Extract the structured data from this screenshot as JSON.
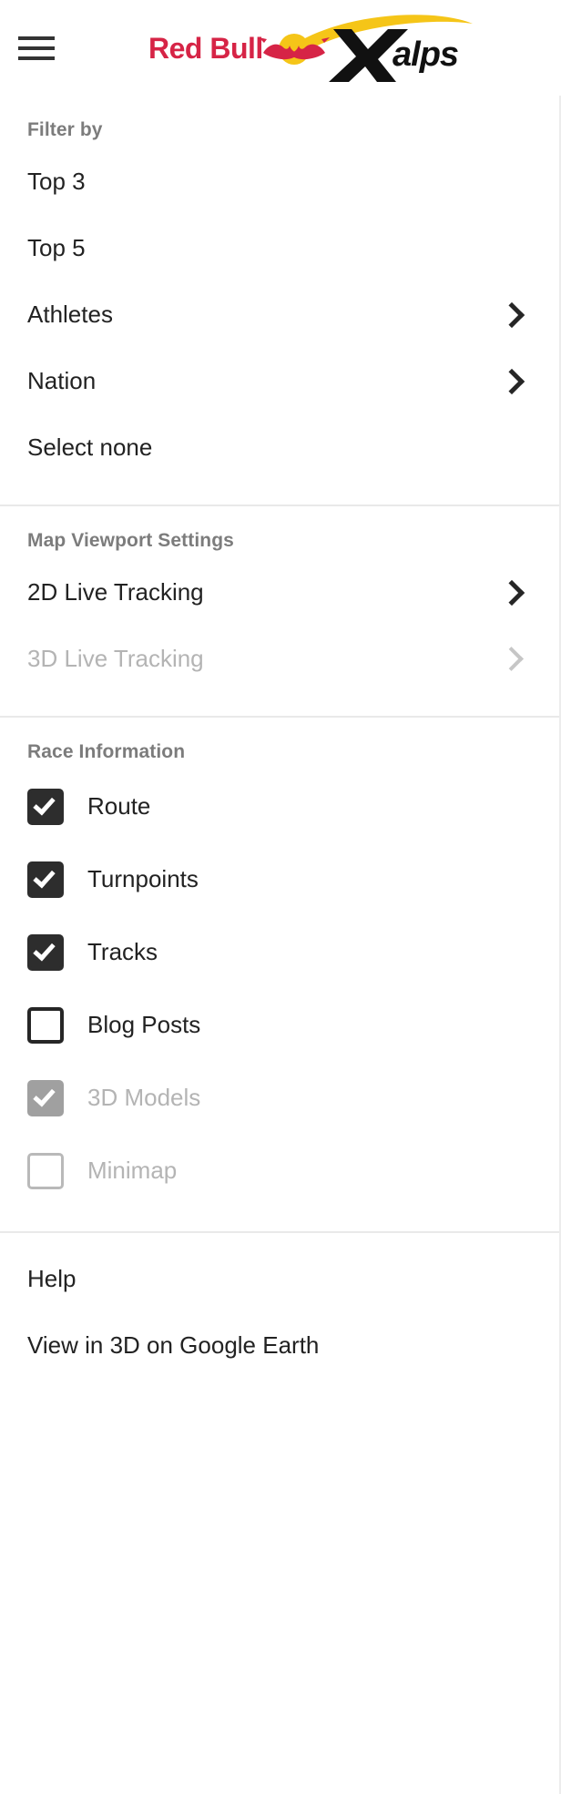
{
  "header": {
    "menu_icon": "hamburger-menu-icon",
    "logo_text_red": "Red Bull",
    "logo_text_black": "X-alps",
    "logo_alt": "Red Bull X-Alps"
  },
  "colors": {
    "redbull_red": "#D62446",
    "redbull_yellow": "#F5C518",
    "text_primary": "#222222",
    "text_muted": "#7C7C7C",
    "text_disabled": "#B4B4B4",
    "checkbox_checked": "#2D2D2D",
    "checkbox_disabled": "#A0A0A0",
    "divider": "#E9E9E9"
  },
  "sections": {
    "filter": {
      "title": "Filter by",
      "items": [
        {
          "label": "Top 3",
          "chevron": false,
          "disabled": false
        },
        {
          "label": "Top 5",
          "chevron": false,
          "disabled": false
        },
        {
          "label": "Athletes",
          "chevron": true,
          "disabled": false
        },
        {
          "label": "Nation",
          "chevron": true,
          "disabled": false
        },
        {
          "label": "Select none",
          "chevron": false,
          "disabled": false
        }
      ]
    },
    "viewport": {
      "title": "Map Viewport Settings",
      "items": [
        {
          "label": "2D Live Tracking",
          "chevron": true,
          "disabled": false
        },
        {
          "label": "3D Live Tracking",
          "chevron": true,
          "disabled": true
        }
      ]
    },
    "race_information": {
      "title": "Race Information",
      "items": [
        {
          "label": "Route",
          "checked": true,
          "disabled": false
        },
        {
          "label": "Turnpoints",
          "checked": true,
          "disabled": false
        },
        {
          "label": "Tracks",
          "checked": true,
          "disabled": false
        },
        {
          "label": "Blog Posts",
          "checked": false,
          "disabled": false
        },
        {
          "label": "3D Models",
          "checked": true,
          "disabled": true
        },
        {
          "label": "Minimap",
          "checked": false,
          "disabled": true
        }
      ]
    },
    "footer": {
      "items": [
        {
          "label": "Help"
        },
        {
          "label": "View in 3D on Google Earth"
        }
      ]
    }
  }
}
